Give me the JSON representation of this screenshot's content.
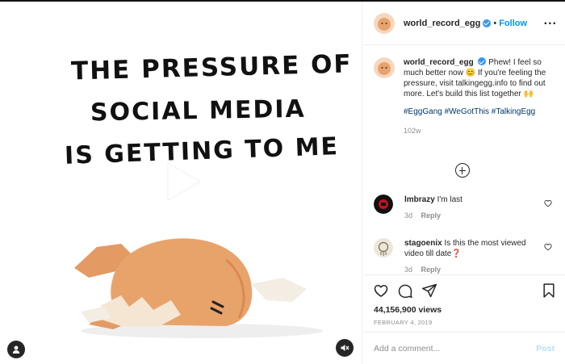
{
  "colors": {
    "link": "#0095f6",
    "hashtag": "#00376b",
    "muted": "#8e8e8e",
    "verified": "#3897f0",
    "post_disabled": "#b2dffc"
  },
  "media": {
    "caption_lines": [
      "THE PRESSURE OF",
      "SOCIAL MEDIA",
      "IS GETTING TO ME"
    ],
    "play_icon": "play-icon",
    "user_tag_icon": "user-icon",
    "mute_icon": "speaker-muted-icon"
  },
  "header": {
    "username": "world_record_egg",
    "separator": "•",
    "follow_label": "Follow",
    "more_label": "..."
  },
  "caption": {
    "username": "world_record_egg",
    "text_1": "Phew! I feel so much better now",
    "emoji_1": "😊",
    "text_2": "If you're feeling the pressure, visit talkingegg.info to find out more. Let's build this list together",
    "emoji_2": "🙌",
    "hashtags": "#EggGang #WeGotThis #TalkingEgg",
    "time": "102w"
  },
  "comments": [
    {
      "username": "lmbrazy",
      "text": "I'm last",
      "time": "3d",
      "reply_label": "Reply"
    },
    {
      "username": "stagoenix",
      "text": "Is this the most viewed video till date",
      "emoji": "❓",
      "time": "3d",
      "reply_label": "Reply"
    }
  ],
  "actions": {
    "views": "44,156,900 views",
    "date": "FEBRUARY 4, 2019"
  },
  "add_comment": {
    "placeholder": "Add a comment...",
    "post_label": "Post"
  }
}
